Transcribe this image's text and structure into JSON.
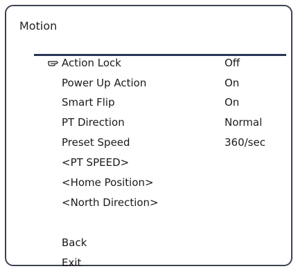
{
  "panel": {
    "title": "Motion"
  },
  "menu": {
    "selected_icon": "pointing-hand-icon",
    "items": [
      {
        "label": "Action Lock",
        "value": "Off",
        "selected": true
      },
      {
        "label": "Power Up Action",
        "value": "On"
      },
      {
        "label": "Smart Flip",
        "value": "On"
      },
      {
        "label": "PT Direction",
        "value": "Normal"
      },
      {
        "label": "Preset Speed",
        "value": "360/sec"
      },
      {
        "label": "<PT SPEED>"
      },
      {
        "label": "<Home Position>"
      },
      {
        "label": "<North Direction>"
      },
      {
        "label": "Back"
      },
      {
        "label": "Exit"
      }
    ]
  },
  "colors": {
    "border": "#3b4250",
    "divider": "#263656",
    "text": "#1a1a1a"
  }
}
